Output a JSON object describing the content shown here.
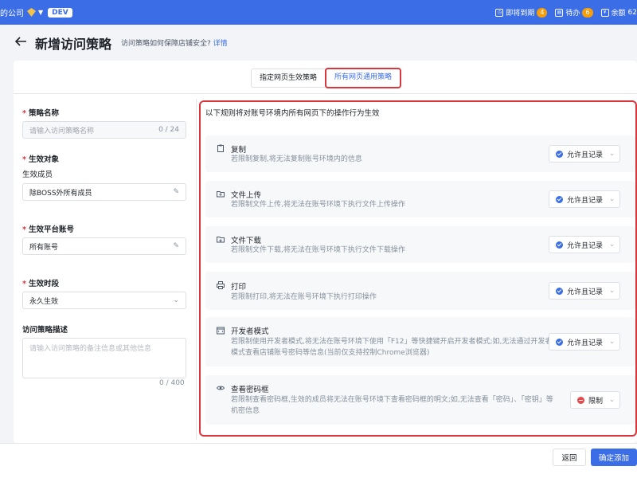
{
  "topbar": {
    "org_name": "的公司",
    "env": "DEV",
    "expiring_label": "即将到期",
    "expiring_count": "4",
    "todo_label": "待办",
    "todo_count": "6",
    "balance_label": "余额",
    "balance_value": "62"
  },
  "header": {
    "title": "新增访问策略",
    "help_text": "访问策略如何保障店铺安全?",
    "help_link": "详情"
  },
  "tabs": [
    {
      "label": "指定网页生效策略",
      "active": false
    },
    {
      "label": "所有网页通用策略",
      "active": true
    }
  ],
  "form": {
    "name_label": "策略名称",
    "name_placeholder": "请输入访问策略名称",
    "name_counter": "0 / 24",
    "target_label": "生效对象",
    "members_label": "生效成员",
    "members_value": "除BOSS外所有成员",
    "platform_label": "生效平台账号",
    "platform_value": "所有账号",
    "period_label": "生效时段",
    "period_value": "永久生效",
    "desc_label": "访问策略描述",
    "desc_placeholder": "请输入访问策略的备注信息或其他信息",
    "desc_counter": "0 / 400"
  },
  "rules": {
    "heading": "以下规则将对账号环境内所有网页下的操作行为生效",
    "items": [
      {
        "icon": "clipboard-icon",
        "title": "复制",
        "desc": "若限制复制,将无法复制账号环境内的信息",
        "value": "允许且记录",
        "status": "allow"
      },
      {
        "icon": "upload-icon",
        "title": "文件上传",
        "desc": "若限制文件上传,将无法在账号环境下执行文件上传操作",
        "value": "允许且记录",
        "status": "allow"
      },
      {
        "icon": "download-icon",
        "title": "文件下载",
        "desc": "若限制文件下载,将无法在账号环境下执行文件下载操作",
        "value": "允许且记录",
        "status": "allow"
      },
      {
        "icon": "printer-icon",
        "title": "打印",
        "desc": "若限制打印,将无法在账号环境下执行打印操作",
        "value": "允许且记录",
        "status": "allow"
      },
      {
        "icon": "devtools-icon",
        "title": "开发者模式",
        "desc": "若限制使用开发者模式,将无法在账号环境下使用「F12」等快捷键开启开发者模式;如,无法通过开发者模式查看店铺账号密码等信息(当前仅支持控制Chrome浏览器)",
        "value": "允许且记录",
        "status": "allow"
      },
      {
        "icon": "eye-icon",
        "title": "查看密码框",
        "desc": "若限制查看密码框,生效的成员将无法在账号环境下查看密码框的明文;如,无法查看「密码」、「密钥」等机密信息",
        "value": "限制",
        "status": "deny"
      }
    ]
  },
  "footer": {
    "back_label": "返回",
    "confirm_label": "确定添加"
  }
}
